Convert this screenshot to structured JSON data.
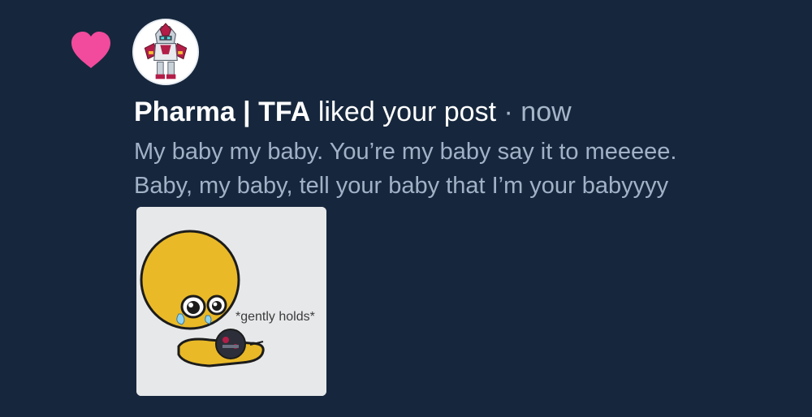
{
  "notification": {
    "username": "Pharma | TFA",
    "action": "liked your post",
    "separator": "·",
    "time": "now",
    "message_lines": [
      "My baby my baby. You’re my baby say it to meeeee.",
      "Baby, my baby, tell your baby that I’m your babyyyy"
    ],
    "thumbnail_caption": "*gently holds*"
  },
  "icons": {
    "like": "heart-icon",
    "avatar": "robot-avatar"
  },
  "colors": {
    "background": "#16273d",
    "heart": "#f24a9c",
    "headline": "#ffffff",
    "muted_text": "#a2b1c6"
  }
}
